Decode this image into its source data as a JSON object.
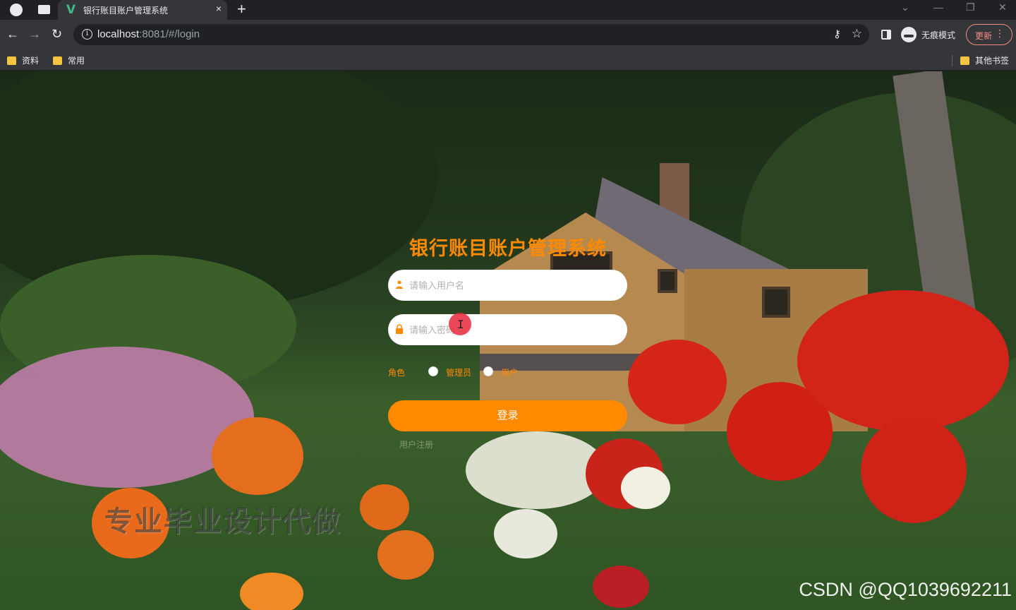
{
  "browser": {
    "tab_title": "银行账目账户管理系统",
    "tab_favicon": "V",
    "tab_close": "×",
    "new_tab": "+",
    "window_controls": [
      "⌄",
      "—",
      "❐",
      "✕"
    ],
    "url_host": "localhost",
    "url_rest": ":8081/#/login",
    "incognito_label": "无痕模式",
    "update_label": "更新",
    "update_menu": "⋮",
    "bookmarks": [
      "资料",
      "常用"
    ],
    "other_bookmarks": "其他书签",
    "icons": [
      "globe-icon",
      "window-icon",
      "back-arrow-icon",
      "forward-arrow-icon",
      "reload-icon",
      "info-icon",
      "key-icon",
      "star-icon",
      "side-panel-icon",
      "incognito-icon",
      "folder-icon"
    ]
  },
  "login": {
    "title": "银行账目账户管理系统",
    "username_placeholder": "请输入用户名",
    "password_placeholder": "请输入密码",
    "role_label": "角色",
    "roles": [
      "管理员",
      "用户"
    ],
    "submit_label": "登录",
    "register_link": "用户注册"
  },
  "watermarks": {
    "overlay_text": "专业毕业设计代做",
    "csdn_text": "CSDN @QQ1039692211"
  },
  "colors": {
    "accent": "#ff8a00",
    "chrome_dark": "#202124",
    "chrome_toolbar": "#35363a"
  }
}
